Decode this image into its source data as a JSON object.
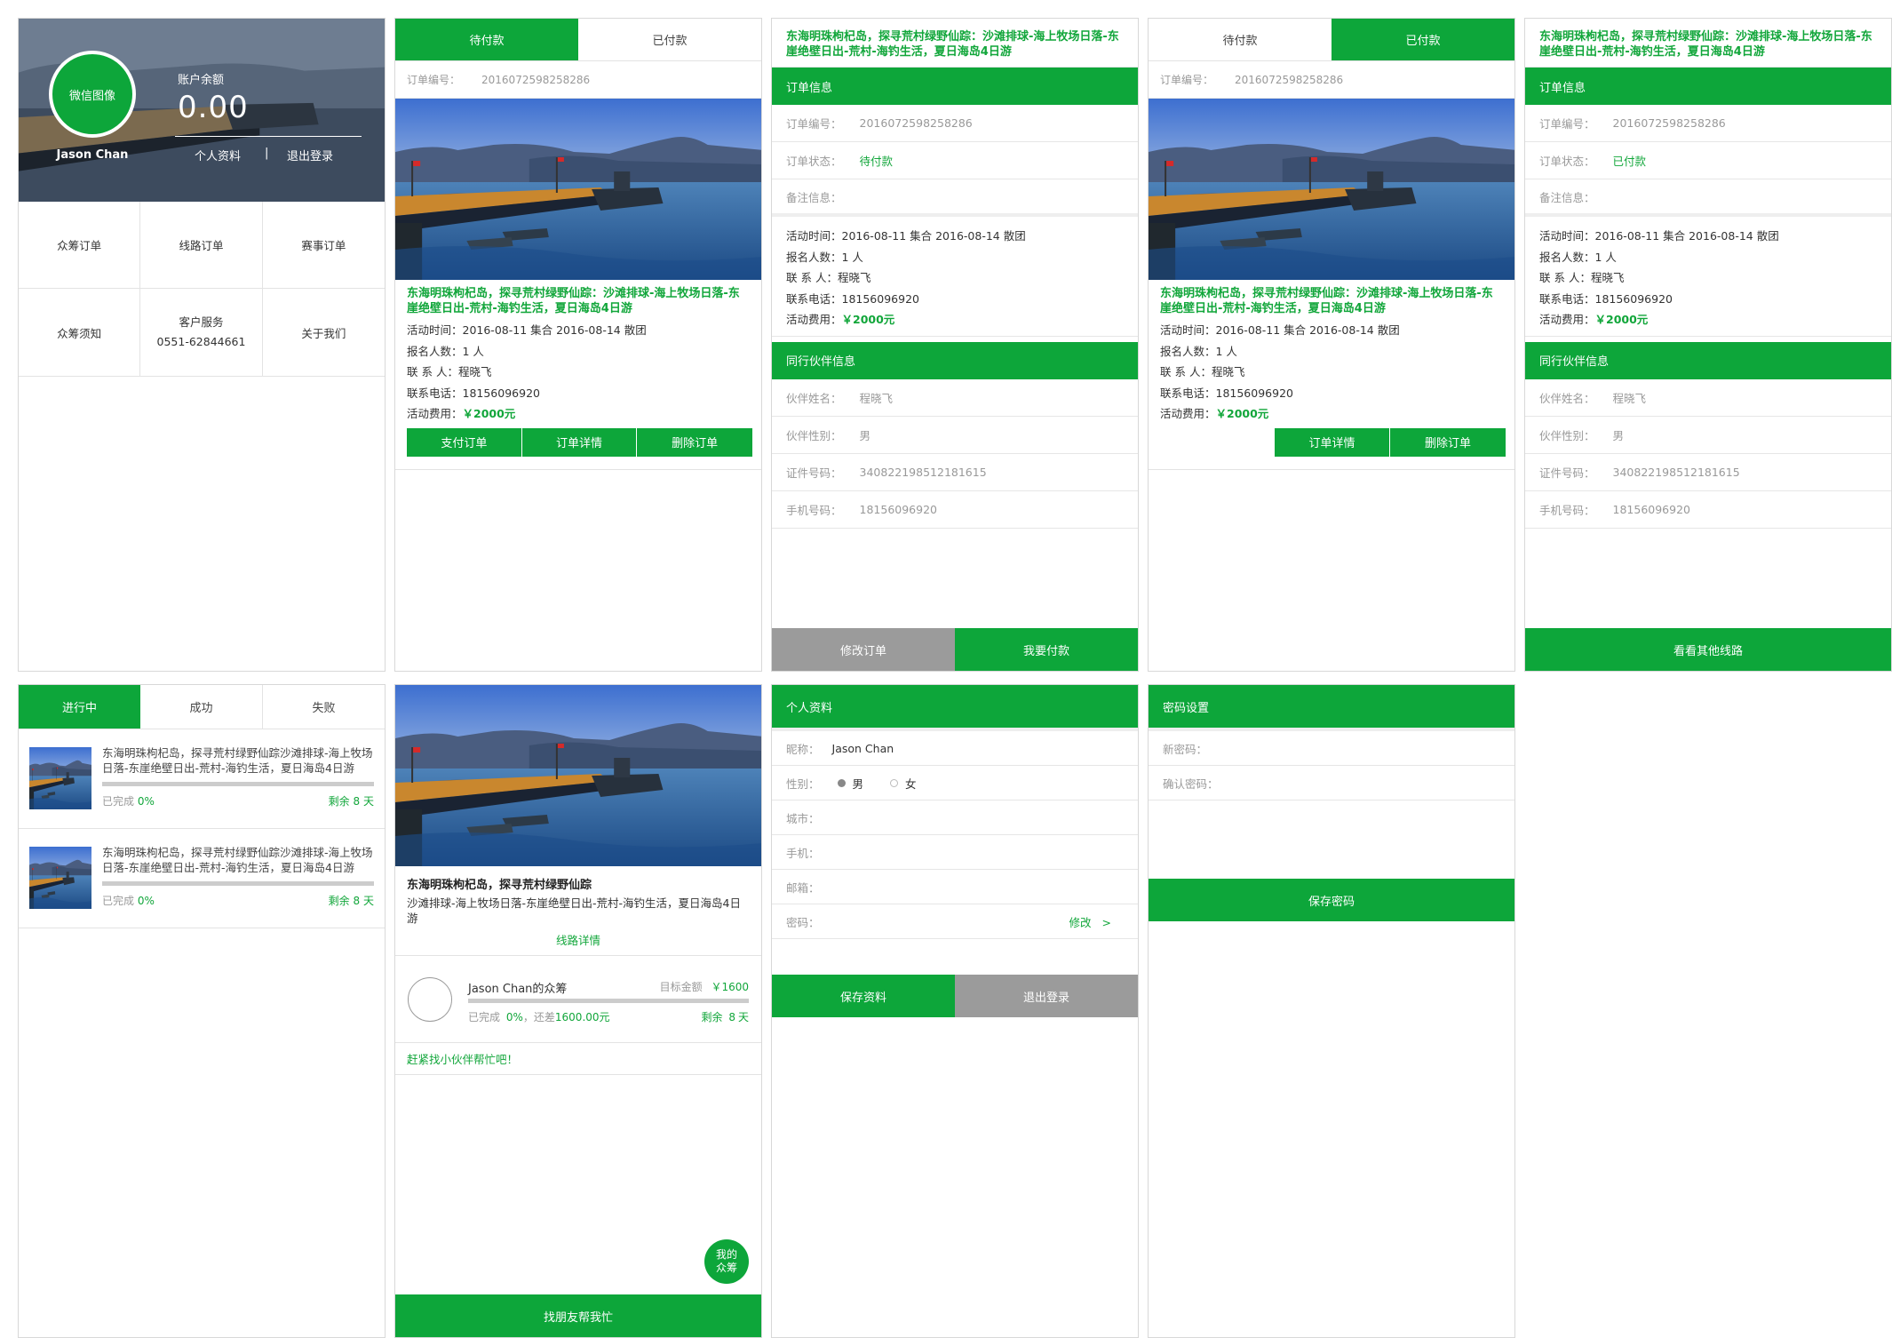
{
  "profile": {
    "avatar_text": "微信图像",
    "username": "Jason Chan",
    "balance_label": "账户余额",
    "balance": "0.00",
    "profile_link": "个人资料",
    "separator": "|",
    "logout_link": "退出登录",
    "grid": [
      {
        "label": "众筹订单"
      },
      {
        "label": "线路订单"
      },
      {
        "label": "赛事订单"
      },
      {
        "label": "众筹须知"
      },
      {
        "label": "客户服务",
        "sub": "0551-62844661"
      },
      {
        "label": "关于我们"
      }
    ]
  },
  "trip": {
    "title": "东海明珠枸杞岛，探寻荒村绿野仙踪：沙滩排球-海上牧场日落-东崖绝壁日出-荒村-海钓生活，夏日海岛4日游",
    "time": "活动时间：2016-08-11 集合  2016-08-14 散团",
    "count": "报名人数：1 人",
    "contact": "联  系  人：程晓飞",
    "phone": "联系电话：18156096920",
    "fee_label": "活动费用：",
    "fee": "￥2000元"
  },
  "order_list_unpaid": {
    "tabs": [
      "待付款",
      "已付款"
    ],
    "order_no_label": "订单编号：",
    "order_no": "2016072598258286",
    "buttons": [
      "支付订单",
      "订单详情",
      "删除订单"
    ]
  },
  "order_detail_unpaid": {
    "section_order": "订单信息",
    "order_no_label": "订单编号：",
    "order_no": "2016072598258286",
    "status_label": "订单状态：",
    "status": "待付款",
    "remark_label": "备注信息：",
    "section_partner": "同行伙伴信息",
    "partner_name_label": "伙伴姓名：",
    "partner_name": "程晓飞",
    "partner_gender_label": "伙伴性别：",
    "partner_gender": "男",
    "partner_id_label": "证件号码：",
    "partner_id": "340822198512181615",
    "partner_mobile_label": "手机号码：",
    "partner_mobile": "18156096920",
    "btn_modify": "修改订单",
    "btn_pay": "我要付款"
  },
  "order_list_paid": {
    "tabs": [
      "待付款",
      "已付款"
    ],
    "order_no_label": "订单编号：",
    "order_no": "2016072598258286",
    "buttons": [
      "订单详情",
      "删除订单"
    ]
  },
  "order_detail_paid": {
    "section_order": "订单信息",
    "order_no_label": "订单编号：",
    "order_no": "2016072598258286",
    "status_label": "订单状态：",
    "status": "已付款",
    "remark_label": "备注信息：",
    "section_partner": "同行伙伴信息",
    "partner_name_label": "伙伴姓名：",
    "partner_name": "程晓飞",
    "partner_gender_label": "伙伴性别：",
    "partner_gender": "男",
    "partner_id_label": "证件号码：",
    "partner_id": "340822198512181615",
    "partner_mobile_label": "手机号码：",
    "partner_mobile": "18156096920",
    "btn_other": "看看其他线路"
  },
  "crowdfund_list": {
    "tabs": [
      "进行中",
      "成功",
      "失败"
    ],
    "items": [
      {
        "title": "东海明珠枸杞岛，探寻荒村绿野仙踪沙滩排球-海上牧场日落-东崖绝壁日出-荒村-海钓生活，夏日海岛4日游",
        "done_label": "已完成",
        "done": "0%",
        "progress": 0,
        "remain_label": "剩余",
        "remain": "8",
        "remain_unit": "天"
      },
      {
        "title": "东海明珠枸杞岛，探寻荒村绿野仙踪沙滩排球-海上牧场日落-东崖绝壁日出-荒村-海钓生活，夏日海岛4日游",
        "done_label": "已完成",
        "done": "0%",
        "progress": 0,
        "remain_label": "剩余",
        "remain": "8",
        "remain_unit": "天"
      }
    ]
  },
  "crowdfund_detail": {
    "title": "东海明珠枸杞岛，探寻荒村绿野仙踪",
    "subtitle": "沙滩排球-海上牧场日落-东崖绝壁日出-荒村-海钓生活，夏日海岛4日游",
    "detail_link": "线路详情",
    "owner": "Jason Chan的众筹",
    "target_label": "目标金额",
    "target": "￥1600",
    "done_label": "已完成",
    "done": "0%",
    "gap_label": "，还差",
    "gap": "1600.00元",
    "progress": 0,
    "remain_label": "剩余",
    "remain": "8",
    "remain_unit": "天",
    "hint": "赶紧找小伙伴帮忙吧！",
    "fab_line1": "我的",
    "fab_line2": "众筹",
    "btn_friends": "找朋友帮我忙"
  },
  "personal": {
    "section": "个人资料",
    "nickname_label": "昵称：",
    "nickname": "Jason Chan",
    "gender_label": "性别：",
    "male": "男",
    "female": "女",
    "city_label": "城市：",
    "mobile_label": "手机：",
    "email_label": "邮箱：",
    "password_label": "密码：",
    "modify_link": "修改",
    "modify_arrow": ">",
    "btn_save": "保存资料",
    "btn_logout": "退出登录"
  },
  "password": {
    "section": "密码设置",
    "new_label": "新密码：",
    "confirm_label": "确认密码：",
    "btn_save": "保存密码"
  },
  "colors": {
    "brand": "#0da63a",
    "gray_button": "#9b9b9b",
    "border": "#d8d8d8"
  }
}
